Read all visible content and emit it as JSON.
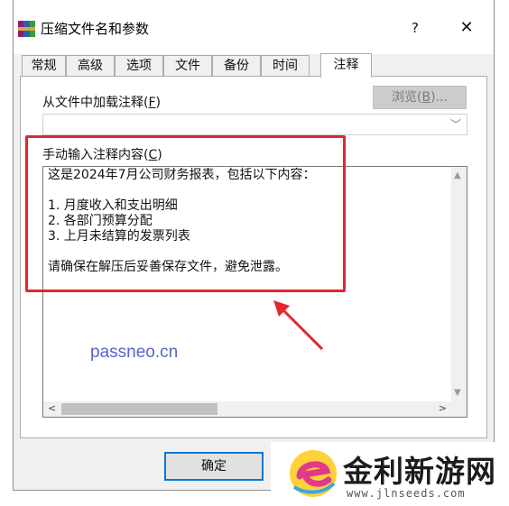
{
  "window": {
    "title": "压缩文件名和参数",
    "help_glyph": "?",
    "close_glyph": "✕"
  },
  "tabs": [
    {
      "label": "常规",
      "active": false
    },
    {
      "label": "高级",
      "active": false
    },
    {
      "label": "选项",
      "active": false
    },
    {
      "label": "文件",
      "active": false
    },
    {
      "label": "备份",
      "active": false
    },
    {
      "label": "时间",
      "active": false
    },
    {
      "label": "注释",
      "active": true
    }
  ],
  "comment_tab": {
    "load_label_prefix": "从文件中加载注释(",
    "load_label_key": "F",
    "load_label_suffix": ")",
    "browse_prefix": "浏览(",
    "browse_key": "B",
    "browse_suffix": ")...",
    "file_value": "",
    "manual_label_prefix": "手动输入注释内容(",
    "manual_label_key": "C",
    "manual_label_suffix": ")",
    "comment_lines": [
      "这是2024年7月公司财务报表，包括以下内容：",
      "",
      "1. 月度收入和支出明细",
      "2. 各部门预算分配",
      "3. 上月未结算的发票列表",
      "",
      "请确保在解压后妥善保存文件，避免泄露。"
    ]
  },
  "buttons": {
    "ok": "确定",
    "cancel": ""
  },
  "overlay": {
    "watermark": "passneo.cn",
    "brand_name": "金利新游网",
    "brand_url": "www.jlnseeds.com",
    "highlight_color": "#e3262d"
  },
  "colors": {
    "accent": "#0078d7",
    "annotation": "#e3262d",
    "watermark": "#5a63c7"
  }
}
